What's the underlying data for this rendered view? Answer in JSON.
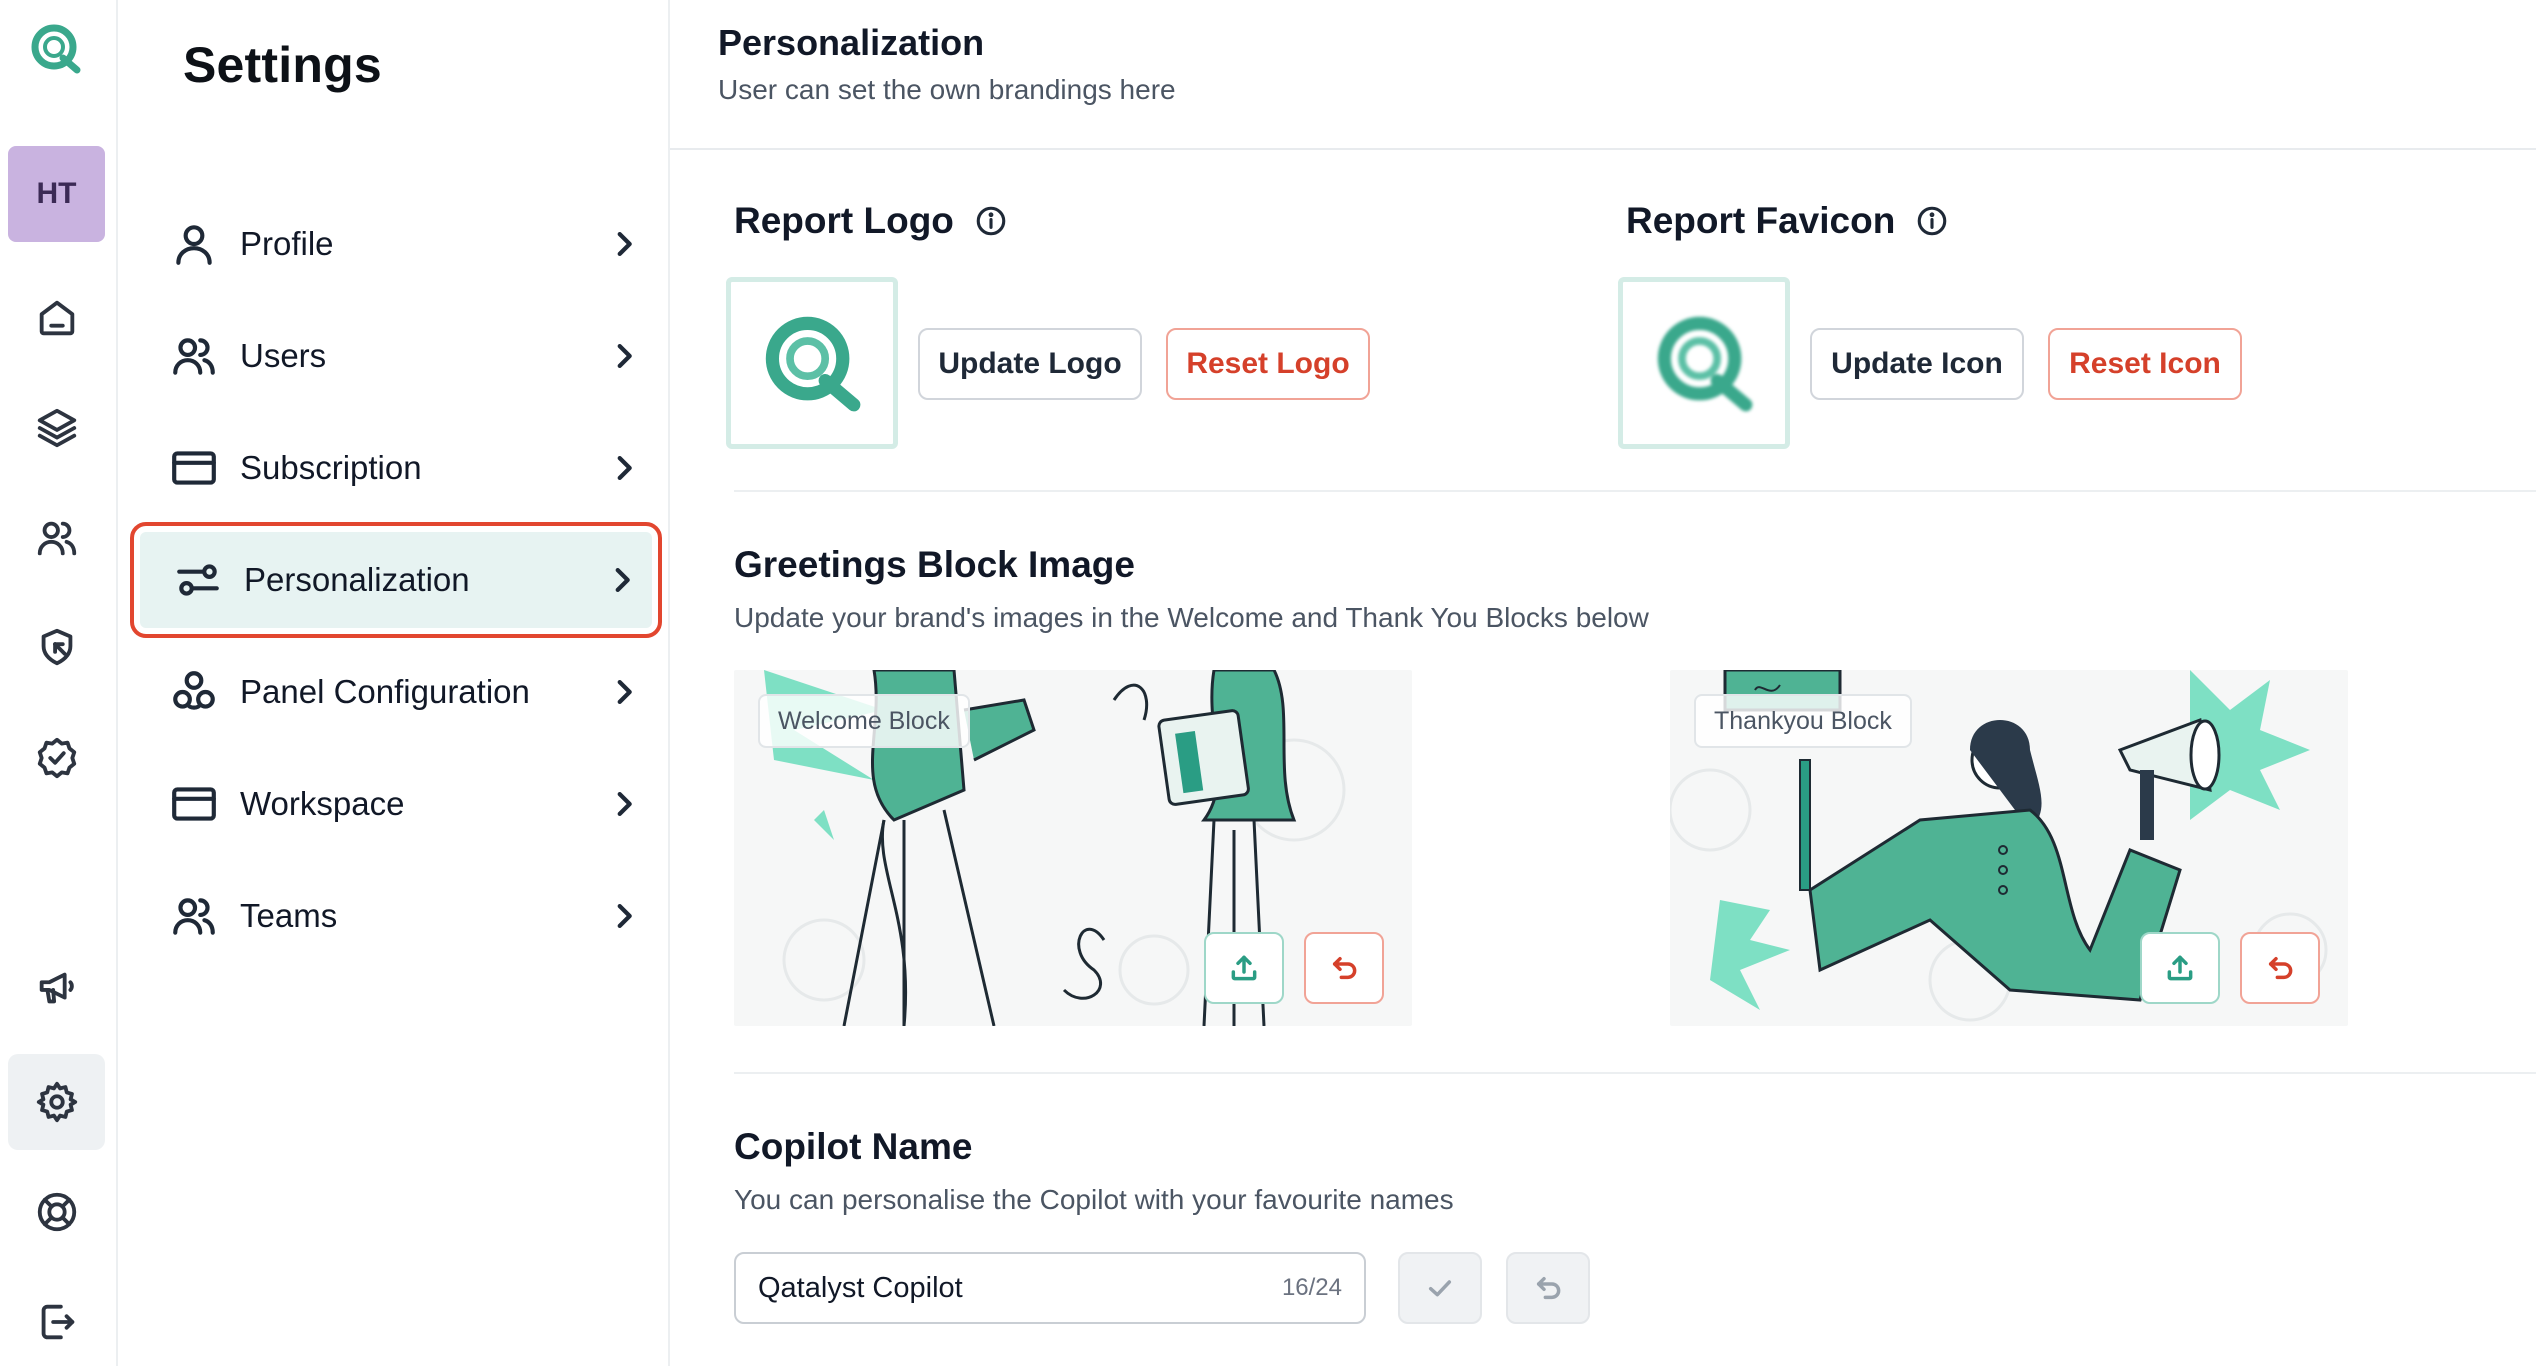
{
  "rail": {
    "avatar_initials": "HT",
    "icons": [
      "app-logo-icon",
      "home-icon",
      "layers-icon",
      "users-icon",
      "pointer-icon",
      "badge-check-icon",
      "megaphone-icon",
      "settings-icon",
      "lifebuoy-icon",
      "logout-icon"
    ]
  },
  "settings": {
    "title": "Settings",
    "items": [
      {
        "label": "Profile"
      },
      {
        "label": "Users"
      },
      {
        "label": "Subscription"
      },
      {
        "label": "Personalization"
      },
      {
        "label": "Panel Configuration"
      },
      {
        "label": "Workspace"
      },
      {
        "label": "Teams"
      }
    ],
    "selected_index": 3
  },
  "header": {
    "title": "Personalization",
    "subtitle": "User can set the own brandings here"
  },
  "report_logo": {
    "title": "Report Logo",
    "update_label": "Update Logo",
    "reset_label": "Reset Logo"
  },
  "report_favicon": {
    "title": "Report Favicon",
    "update_label": "Update Icon",
    "reset_label": "Reset Icon"
  },
  "greetings": {
    "title": "Greetings Block Image",
    "subtitle": "Update your brand's images in the Welcome and Thank You Blocks below",
    "welcome_tag": "Welcome Block",
    "thankyou_tag": "Thankyou Block"
  },
  "copilot": {
    "title": "Copilot Name",
    "subtitle": "You can personalise the Copilot with your favourite names",
    "value": "Qatalyst Copilot",
    "counter": "16/24"
  },
  "colors": {
    "brand_teal": "#3aa88c",
    "accent_red": "#d5402a",
    "selected_bg": "#e7f3f2",
    "avatar_bg": "#c9b3e0"
  }
}
